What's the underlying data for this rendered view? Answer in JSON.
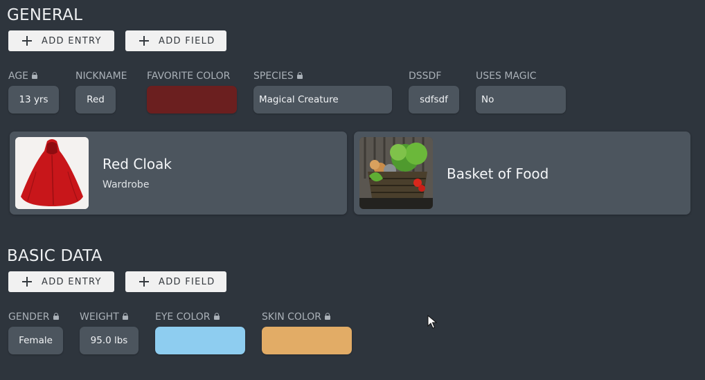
{
  "general": {
    "title": "GENERAL",
    "add_entry": "ADD ENTRY",
    "add_field": "ADD FIELD",
    "fields": {
      "age": {
        "label": "AGE",
        "value": "13 yrs",
        "locked": true
      },
      "nickname": {
        "label": "NICKNAME",
        "value": "Red"
      },
      "favorite_color": {
        "label": "FAVORITE COLOR",
        "color": "#6b1f1f"
      },
      "species": {
        "label": "SPECIES",
        "value": "Magical Creature",
        "locked": true
      },
      "dssdf": {
        "label": "DSSDF",
        "value": "sdfsdf"
      },
      "uses_magic": {
        "label": "USES MAGIC",
        "value": "No"
      }
    },
    "cards": [
      {
        "title": "Red Cloak",
        "subtitle": "Wardrobe",
        "image": "red-cloak-image"
      },
      {
        "title": "Basket of Food",
        "image": "basket-of-food-image"
      }
    ]
  },
  "basic_data": {
    "title": "BASIC DATA",
    "add_entry": "ADD ENTRY",
    "add_field": "ADD FIELD",
    "fields": {
      "gender": {
        "label": "GENDER",
        "value": "Female",
        "locked": true
      },
      "weight": {
        "label": "WEIGHT",
        "value": "95.0 lbs",
        "locked": true
      },
      "eye_color": {
        "label": "EYE COLOR",
        "color": "#8ecdf0",
        "locked": true
      },
      "skin_color": {
        "label": "SKIN COLOR",
        "color": "#e2ac66",
        "locked": true
      }
    }
  }
}
